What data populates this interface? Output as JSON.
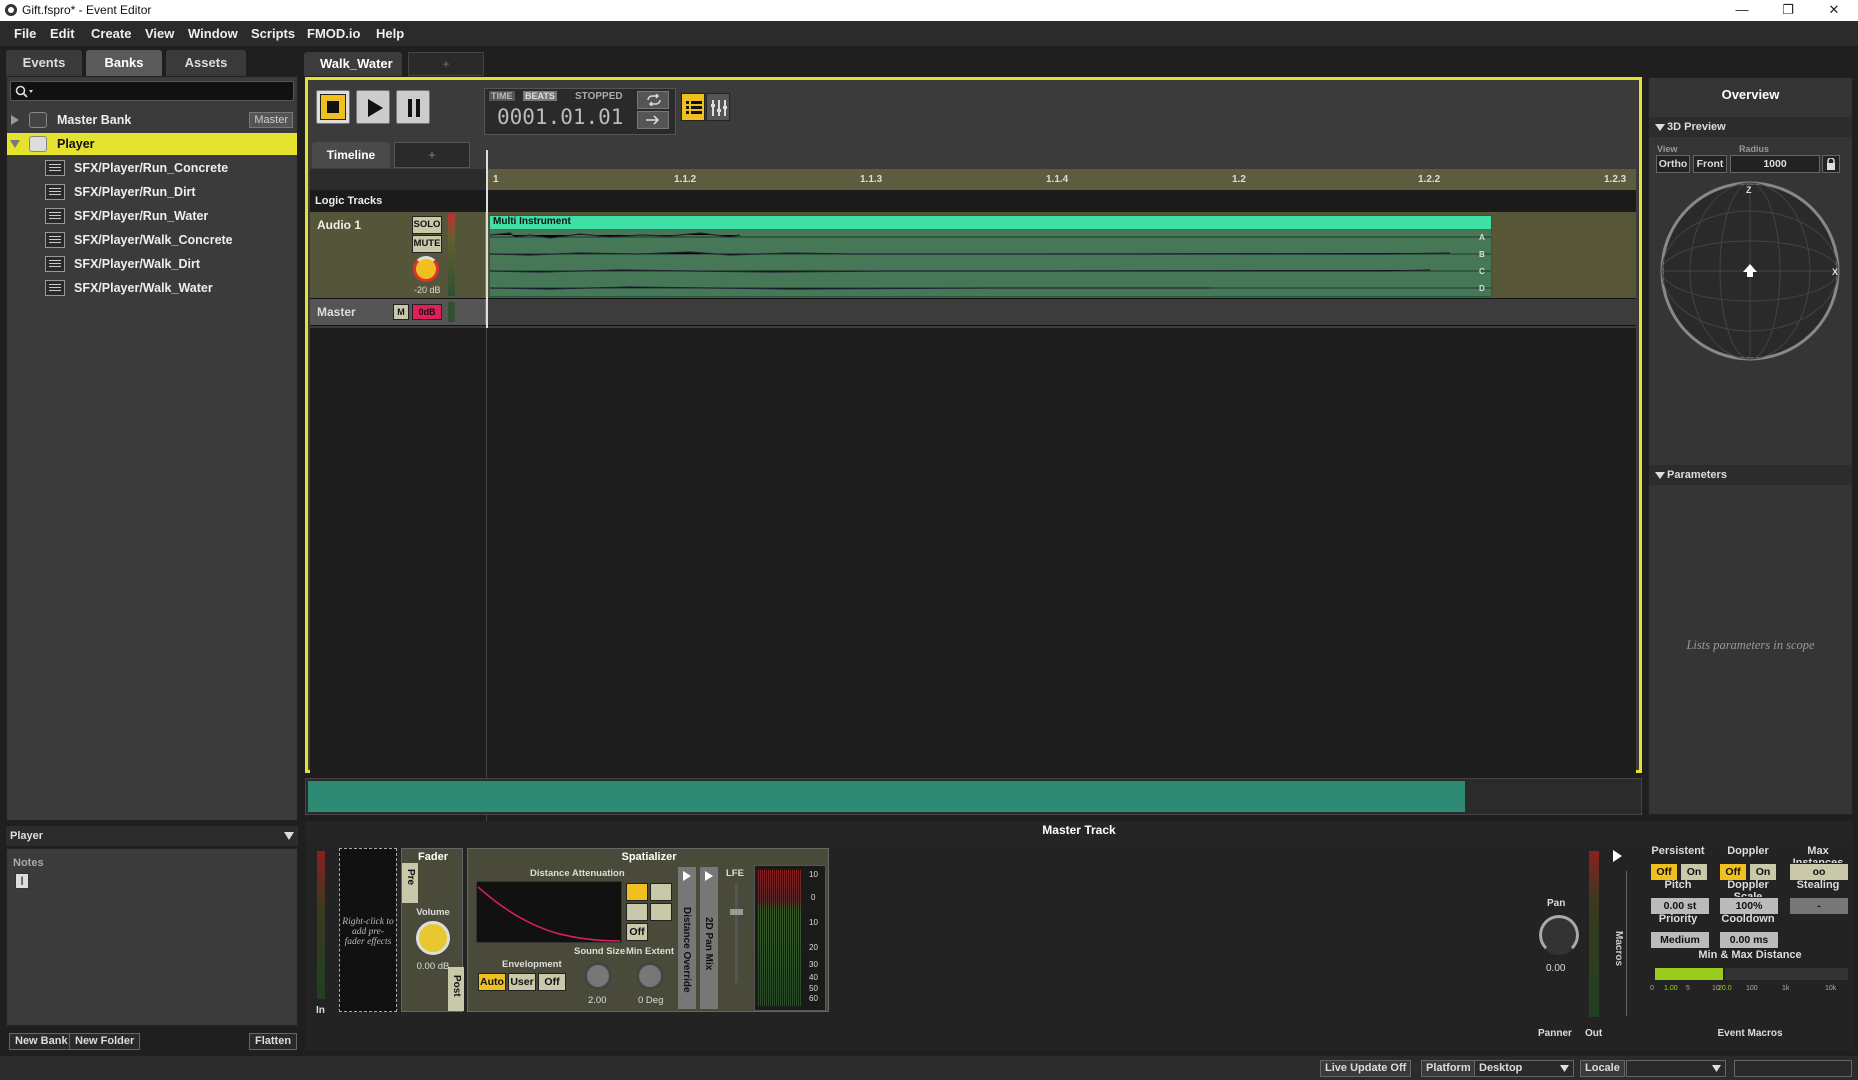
{
  "window": {
    "title": "Gift.fspro* - Event Editor",
    "minimize": "—",
    "restore": "❐",
    "close": "✕"
  },
  "menu": [
    "File",
    "Edit",
    "Create",
    "View",
    "Window",
    "Scripts",
    "FMOD.io",
    "Help"
  ],
  "left": {
    "tabs": [
      "Events",
      "Banks",
      "Assets"
    ],
    "search_placeholder": "",
    "tree": [
      {
        "label": "Master Bank",
        "tag": "Master"
      },
      {
        "label": "Player"
      },
      {
        "label": "SFX/Player/Run_Concrete"
      },
      {
        "label": "SFX/Player/Run_Dirt"
      },
      {
        "label": "SFX/Player/Run_Water"
      },
      {
        "label": "SFX/Player/Walk_Concrete"
      },
      {
        "label": "SFX/Player/Walk_Dirt"
      },
      {
        "label": "SFX/Player/Walk_Water"
      }
    ],
    "props_title": "Player",
    "notes_label": "Notes",
    "buttons": {
      "new_bank": "New Bank",
      "new_folder": "New Folder",
      "flatten": "Flatten"
    }
  },
  "editor": {
    "event_tab": "Walk_Water",
    "plus": "+",
    "transport": {
      "time": "TIME",
      "beats": "BEATS",
      "state": "STOPPED",
      "position": "0001.01.01"
    },
    "timeline_tab": "Timeline",
    "ruler": [
      "1",
      "1.1.2",
      "1.1.3",
      "1.1.4",
      "1.2",
      "1.2.2",
      "1.2.3"
    ],
    "logic_tracks": "Logic Tracks",
    "audio_track": {
      "name": "Audio 1",
      "solo": "SOLO",
      "mute": "MUTE",
      "volume": "-20 dB"
    },
    "region": {
      "name": "Multi Instrument",
      "lanes": [
        "A",
        "B",
        "C",
        "D"
      ]
    },
    "master_track": {
      "name": "Master",
      "m": "M",
      "vol": "0dB"
    }
  },
  "overview": {
    "title": "Overview",
    "preview": "3D Preview",
    "view_label": "View",
    "radius_label": "Radius",
    "ortho": "Ortho",
    "front": "Front",
    "radius": "1000",
    "z": "Z",
    "x": "X",
    "parameters": "Parameters",
    "params_hint": "Lists parameters in scope"
  },
  "deck": {
    "title": "Master Track",
    "in": "In",
    "out": "Out",
    "prefader_hint": "Right-click to add pre-fader effects",
    "fader": {
      "title": "Fader",
      "pre": "Pre",
      "post": "Post",
      "volume_label": "Volume",
      "volume": "0.00 dB"
    },
    "spatializer": {
      "title": "Spatializer",
      "distance": "Distance Attenuation",
      "off": "Off",
      "envelopment": "Envelopment",
      "auto": "Auto",
      "user": "User",
      "off2": "Off",
      "sound_size": "Sound Size",
      "sound_size_val": "2.00",
      "min_extent": "Min Extent",
      "min_extent_val": "0 Deg",
      "distance_override": "Distance Override",
      "pan_mix": "2D Pan Mix",
      "lfe": "LFE",
      "meter_ticks": [
        "10",
        "0",
        "10",
        "20",
        "30",
        "40",
        "50",
        "60"
      ]
    },
    "pan": {
      "label": "Pan",
      "value": "0.00",
      "panner": "Panner"
    },
    "macros": {
      "side": "Macros",
      "title": "Event Macros",
      "persistent": "Persistent",
      "doppler": "Doppler",
      "max_instances": "Max Instances",
      "off": "Off",
      "on": "On",
      "max_val": "oo",
      "pitch": "Pitch",
      "pitch_val": "0.00 st",
      "doppler_scale": "Doppler Scale",
      "doppler_scale_val": "100%",
      "stealing": "Stealing",
      "stealing_val": "-",
      "priority": "Priority",
      "priority_val": "Medium",
      "cooldown": "Cooldown",
      "cooldown_val": "0.00 ms",
      "minmax": "Min & Max Distance",
      "scale": [
        "0",
        "1.00",
        "5",
        "10",
        "20.0",
        "100",
        "1k",
        "10k"
      ]
    }
  },
  "status": {
    "live_update": "Live Update Off",
    "platform_label": "Platform",
    "platform": "Desktop",
    "locale_label": "Locale",
    "locale": ""
  }
}
